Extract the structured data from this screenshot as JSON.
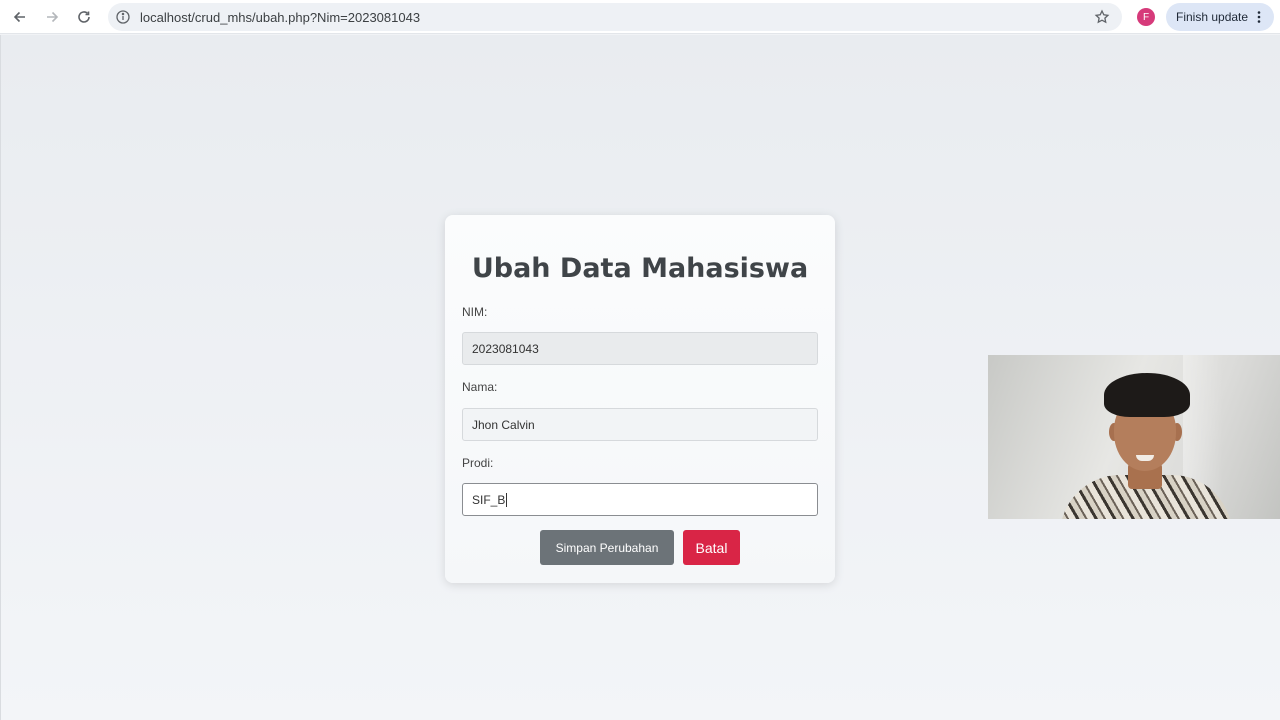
{
  "browser": {
    "url": "localhost/crud_mhs/ubah.php?Nim=2023081043",
    "profile_initial": "F",
    "finish_update_label": "Finish update",
    "icons": [
      "back-arrow-icon",
      "forward-arrow-icon",
      "reload-icon",
      "info-icon",
      "star-icon",
      "kebab-menu-icon"
    ]
  },
  "form": {
    "title": "Ubah Data Mahasiswa",
    "nim_label": "NIM:",
    "nim_value": "2023081043",
    "nama_label": "Nama:",
    "nama_value": "Jhon Calvin",
    "prodi_label": "Prodi:",
    "prodi_value": "SIF_B",
    "save_label": "Simpan Perubahan",
    "cancel_label": "Batal"
  },
  "colors": {
    "save_button": "#6c7378",
    "cancel_button": "#d92546",
    "avatar": "#d63a7a",
    "finish_update_bg": "#dde6f6"
  }
}
